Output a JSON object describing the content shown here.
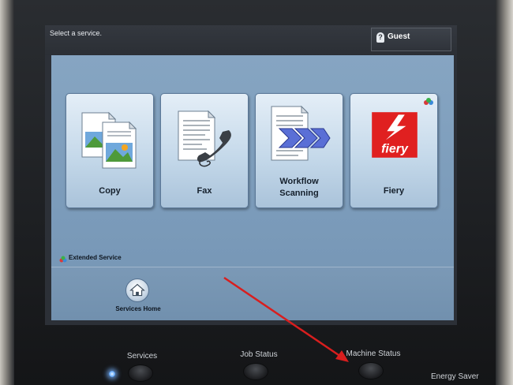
{
  "topbar": {
    "prompt": "Select a service.",
    "user_label": "Guest",
    "user_icon": "?"
  },
  "tiles": [
    {
      "label": "Copy",
      "icon": "copy-icon"
    },
    {
      "label": "Fax",
      "icon": "fax-icon"
    },
    {
      "label": "Workflow\nScanning",
      "icon": "workflow-scanning-icon"
    },
    {
      "label": "Fiery",
      "icon": "fiery-icon",
      "logo_text": "fiery"
    }
  ],
  "extended_service": {
    "label": "Extended Service"
  },
  "services_home": {
    "label": "Services Home",
    "icon": "home-icon"
  },
  "hardware": {
    "services": "Services",
    "job_status": "Job Status",
    "machine_status": "Machine Status",
    "energy_saver": "Energy Saver"
  },
  "annotation": {
    "color": "#d81e1e",
    "points_to": "machine-status-button"
  },
  "colors": {
    "panel": "#7b9bba",
    "tile": "#c5d9ea",
    "fiery_red": "#e02020"
  }
}
